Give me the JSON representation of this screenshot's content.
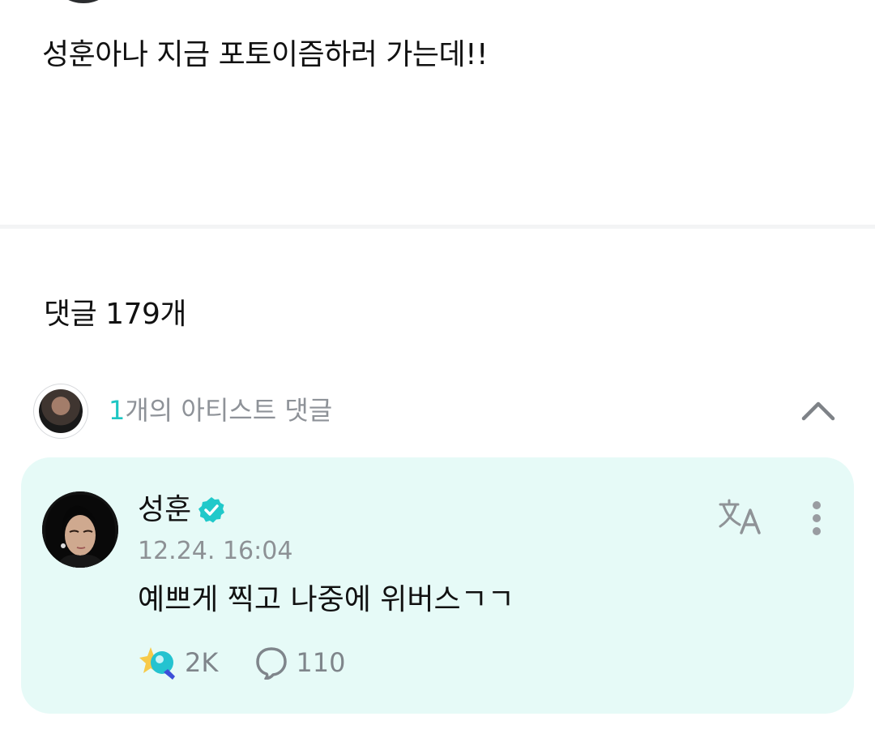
{
  "post": {
    "text": "성훈아나 지금 포토이즘하러 가는데!!"
  },
  "comments": {
    "header": "댓글 179개"
  },
  "artist_comments": {
    "count": "1",
    "label": "개의 아티스트 댓글",
    "collapse_icon": "chevron-up-icon"
  },
  "comment": {
    "author": "성훈",
    "verified_icon": "verified-badge-icon",
    "timestamp": "12.24. 16:04",
    "text": "예쁘게 찍고 나중에 위버스ㄱㄱ",
    "translate_icon": "translate-icon",
    "more_icon": "more-vertical-icon",
    "like_count": "2K",
    "reply_count": "110",
    "like_icon": "sparkle-reaction-icon",
    "reply_icon": "speech-bubble-icon"
  },
  "colors": {
    "accent": "#1dc6c3",
    "card_background": "#e6faf7",
    "muted_text": "#8d9195"
  }
}
